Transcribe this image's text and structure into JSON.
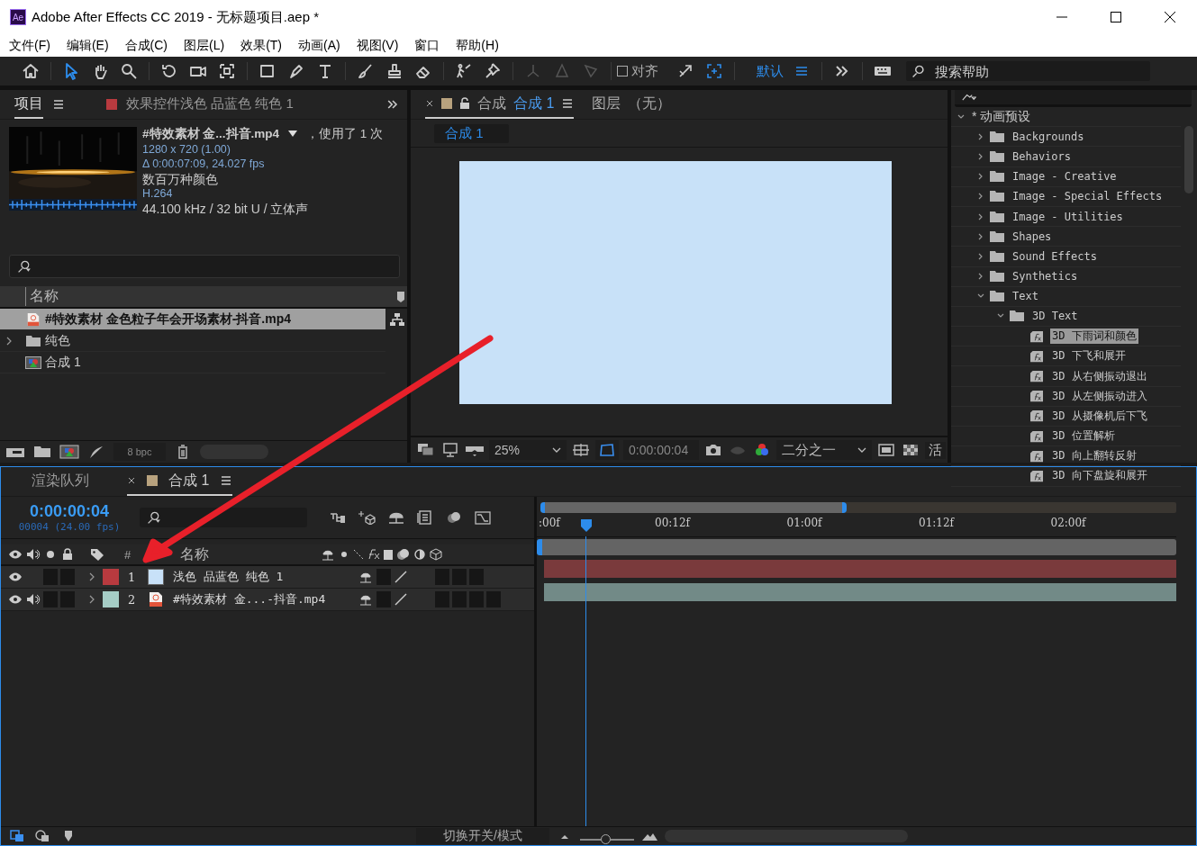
{
  "window": {
    "badge": "Ae",
    "title": "Adobe After Effects CC 2019 - 无标题项目.aep *"
  },
  "menu": [
    "文件(F)",
    "编辑(E)",
    "合成(C)",
    "图层(L)",
    "效果(T)",
    "动画(A)",
    "视图(V)",
    "窗口",
    "帮助(H)"
  ],
  "toolbar": {
    "tools": [
      {
        "kind": "home",
        "selected": false
      },
      {
        "kind": "selection",
        "selected": true
      },
      {
        "kind": "hand",
        "selected": false
      },
      {
        "kind": "zoom",
        "selected": false
      },
      {
        "kind": "rotate",
        "selected": false
      },
      {
        "kind": "camera",
        "selected": false
      },
      {
        "kind": "pan",
        "selected": false
      },
      {
        "kind": "rectangle",
        "selected": false
      },
      {
        "kind": "pen",
        "selected": false
      },
      {
        "kind": "type",
        "selected": false
      },
      {
        "kind": "brush",
        "selected": false
      },
      {
        "kind": "stamp",
        "selected": false
      },
      {
        "kind": "eraser",
        "selected": false
      },
      {
        "kind": "puppet",
        "selected": false
      },
      {
        "kind": "pin",
        "selected": false
      }
    ],
    "align": {
      "label": "对齐",
      "checked": false
    },
    "workspace": "默认",
    "search_placeholder": "搜索帮助"
  },
  "project": {
    "tabs": [
      {
        "label": "项目",
        "selected": true
      },
      {
        "label": "效果控件浅色 品蓝色 纯色 1",
        "selected": false
      }
    ],
    "footage": {
      "name": "#特效素材 金...抖音.mp4",
      "usage": "，使用了 1 次",
      "size": "1280 x 720 (1.00)",
      "duration": "Δ 0:00:07:09, 24.027 fps",
      "colors": "数百万种颜色",
      "codec": "H.264",
      "audio": "44.100 kHz / 32 bit U / 立体声"
    },
    "column": "名称",
    "items": [
      {
        "kind": "footage",
        "name": "#特效素材 金色粒子年会开场素材-抖音.mp4",
        "selected": true
      },
      {
        "kind": "folder",
        "name": "纯色",
        "selected": false
      },
      {
        "kind": "comp",
        "name": "合成 1",
        "selected": false
      }
    ],
    "bpc": "8 bpc"
  },
  "composition": {
    "tabs": [
      {
        "prefix": "合成",
        "label": "合成 1",
        "selected": true
      },
      {
        "prefix": "图层",
        "label": "（无）",
        "selected": false
      }
    ],
    "breadcrumb": "合成 1",
    "zoom": "25%",
    "timecode": "0:00:00:04",
    "resolution": "二分之一",
    "more": "活"
  },
  "presets": {
    "root": {
      "label": "* 动画预设",
      "expanded": true
    },
    "items": [
      {
        "kind": "folder",
        "label": "Backgrounds",
        "expanded": false
      },
      {
        "kind": "folder",
        "label": "Behaviors",
        "expanded": false
      },
      {
        "kind": "folder",
        "label": "Image - Creative",
        "expanded": false
      },
      {
        "kind": "folder",
        "label": "Image - Special Effects",
        "expanded": false
      },
      {
        "kind": "folder",
        "label": "Image - Utilities",
        "expanded": false
      },
      {
        "kind": "folder",
        "label": "Shapes",
        "expanded": false
      },
      {
        "kind": "folder",
        "label": "Sound Effects",
        "expanded": false
      },
      {
        "kind": "folder",
        "label": "Synthetics",
        "expanded": false
      },
      {
        "kind": "folder",
        "label": "Text",
        "expanded": true,
        "children": [
          {
            "kind": "folder",
            "label": "3D Text",
            "expanded": true,
            "children": [
              {
                "kind": "preset",
                "label": "3D 下雨词和颜色",
                "selected": true
              },
              {
                "kind": "preset",
                "label": "3D 下飞和展开",
                "selected": false
              },
              {
                "kind": "preset",
                "label": "3D 从右侧振动退出",
                "selected": false
              },
              {
                "kind": "preset",
                "label": "3D 从左侧振动进入",
                "selected": false
              },
              {
                "kind": "preset",
                "label": "3D 从摄像机后下飞",
                "selected": false
              },
              {
                "kind": "preset",
                "label": "3D 位置解析",
                "selected": false
              },
              {
                "kind": "preset",
                "label": "3D 向上翻转反射",
                "selected": false
              },
              {
                "kind": "preset",
                "label": "3D 向下盘旋和展开",
                "selected": false
              }
            ]
          }
        ]
      }
    ]
  },
  "timeline": {
    "tabs": [
      {
        "label": "渲染队列",
        "selected": false,
        "closable": false
      },
      {
        "label": "合成 1",
        "selected": true,
        "closable": true
      }
    ],
    "timecode": "0:00:00:04",
    "frame_info": "00004 (24.00 fps)",
    "number_header": "#",
    "name_header": "名称",
    "layers": [
      {
        "number": "1",
        "name": "浅色 品蓝色 纯色 1",
        "kind": "solid",
        "color": "#b83a3f",
        "audio": false
      },
      {
        "number": "2",
        "name": "#特效素材 金...-抖音.mp4",
        "kind": "footage",
        "color": "#a6cdc6",
        "audio": true
      }
    ],
    "ruler": [
      ":00f",
      "00:12f",
      "01:00f",
      "01:12f",
      "02:00f"
    ],
    "footer": "切换开关/模式",
    "zoom_slider": {
      "level": 0.45
    }
  }
}
